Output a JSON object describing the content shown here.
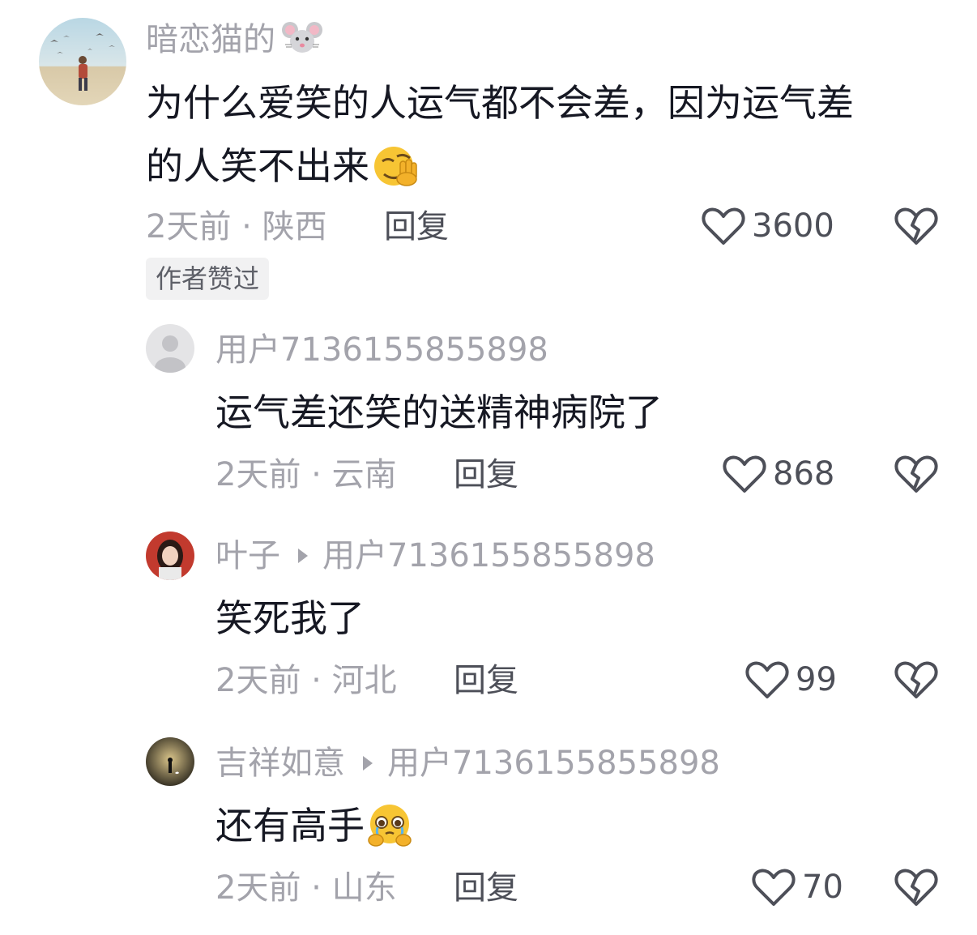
{
  "comments": [
    {
      "username": "暗恋猫的",
      "username_emoji": "mouse-face-icon",
      "text_line1": "为什么爱笑的人运气都不会差，因为运气差",
      "text_line2": "的人笑不出来",
      "text_emoji": "face-with-hand-over-eyes-icon",
      "time": "2天前 · 陕西",
      "reply_label": "回复",
      "likes": "3600",
      "badge": "作者赞过"
    }
  ],
  "replies": [
    {
      "username": "用户7136155855898",
      "reply_to": "",
      "text": "运气差还笑的送精神病院了",
      "time": "2天前 · 云南",
      "reply_label": "回复",
      "likes": "868"
    },
    {
      "username": "叶子",
      "reply_to": "用户7136155855898",
      "text": "笑死我了",
      "time": "2天前 · 河北",
      "reply_label": "回复",
      "likes": "99"
    },
    {
      "username": "吉祥如意",
      "reply_to": "用户7136155855898",
      "text": "还有高手",
      "text_emoji": "pleading-crying-face-icon",
      "time": "2天前 · 山东",
      "reply_label": "回复",
      "likes": "70"
    }
  ],
  "colors": {
    "username": "#a3a3ab",
    "text": "#161823",
    "action": "#4d4f58",
    "badge_bg": "#f1f1f2"
  }
}
